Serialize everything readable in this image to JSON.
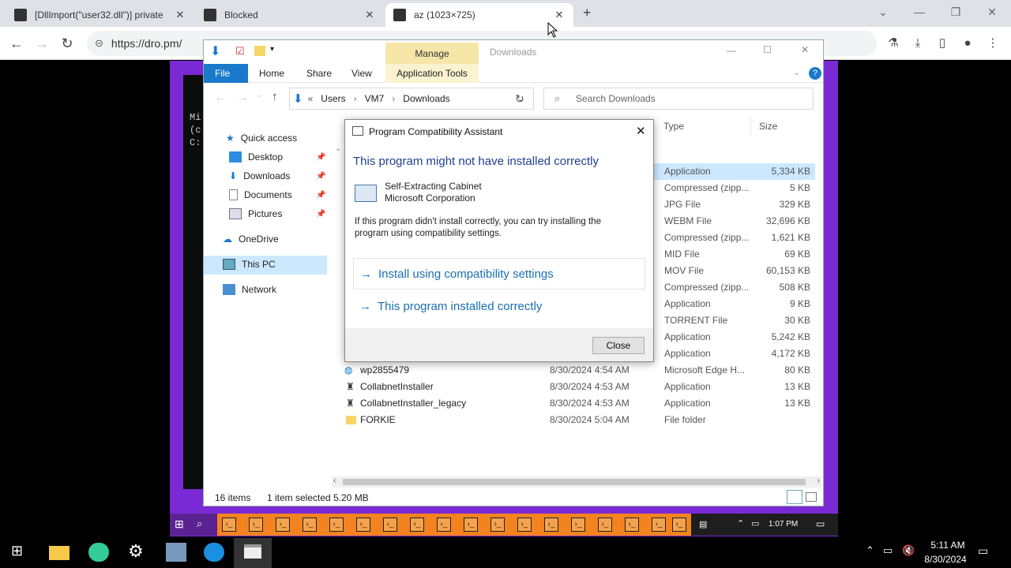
{
  "browser": {
    "tabs": [
      {
        "title": "[DllImport(\"user32.dll\")] private",
        "icon": "code-icon"
      },
      {
        "title": "Blocked",
        "icon": "image-icon"
      },
      {
        "title": "az (1023×725)",
        "icon": "image-icon"
      }
    ],
    "new_tab": "+",
    "url": "https://dro.pm/"
  },
  "explorer": {
    "manage_label": "Manage",
    "title": "Downloads",
    "ribbon": {
      "file": "File",
      "home": "Home",
      "share": "Share",
      "view": "View",
      "app_tools": "Application Tools"
    },
    "address": {
      "prefix": "«",
      "parts": [
        "Users",
        "VM7",
        "Downloads"
      ]
    },
    "search_placeholder": "Search Downloads",
    "nav": {
      "quick_access": "Quick access",
      "desktop": "Desktop",
      "downloads": "Downloads",
      "documents": "Documents",
      "pictures": "Pictures",
      "onedrive": "OneDrive",
      "this_pc": "This PC",
      "network": "Network"
    },
    "columns": {
      "type": "Type",
      "size": "Size"
    },
    "rows_partial": [
      {
        "type": "Application",
        "size": "5,334 KB"
      },
      {
        "type": "Compressed (zipp...",
        "size": "5 KB"
      },
      {
        "type": "JPG File",
        "size": "329 KB"
      },
      {
        "type": "WEBM File",
        "size": "32,696 KB"
      },
      {
        "type": "Compressed (zipp...",
        "size": "1,621 KB"
      },
      {
        "type": "MID File",
        "size": "69 KB"
      },
      {
        "type": "MOV File",
        "size": "60,153 KB"
      },
      {
        "type": "Compressed (zipp...",
        "size": "508 KB"
      },
      {
        "type": "Application",
        "size": "9 KB"
      },
      {
        "type": "TORRENT File",
        "size": "30 KB"
      },
      {
        "type": "Application",
        "size": "5,242 KB"
      },
      {
        "type": "Application",
        "size": "4,172 KB"
      }
    ],
    "rows_full": [
      {
        "name": "wp2855479",
        "date": "8/30/2024 4:54 AM",
        "type": "Microsoft Edge H...",
        "size": "80 KB"
      },
      {
        "name": "CollabnetInstaller",
        "date": "8/30/2024 4:53 AM",
        "type": "Application",
        "size": "13 KB"
      },
      {
        "name": "CollabnetInstaller_legacy",
        "date": "8/30/2024 4:53 AM",
        "type": "Application",
        "size": "13 KB"
      },
      {
        "name": "FORKIE",
        "date": "8/30/2024 5:04 AM",
        "type": "File folder",
        "size": ""
      }
    ],
    "status": {
      "count": "16 items",
      "selected": "1 item selected",
      "size": "5.20 MB"
    }
  },
  "dialog": {
    "title": "Program Compatibility Assistant",
    "heading": "This program might not have installed correctly",
    "program_name": "Self-Extracting Cabinet",
    "publisher": "Microsoft Corporation",
    "body": "If this program didn't install correctly, you can try installing the program using compatibility settings.",
    "option1": "Install using compatibility settings",
    "option2": "This program installed correctly",
    "close": "Close"
  },
  "cmd": {
    "lines": [
      "Mi",
      "(c",
      "",
      "C:"
    ]
  },
  "vm_taskbar": {
    "time": "1:07 PM"
  },
  "host_taskbar": {
    "time": "5:11 AM",
    "date": "8/30/2024"
  }
}
